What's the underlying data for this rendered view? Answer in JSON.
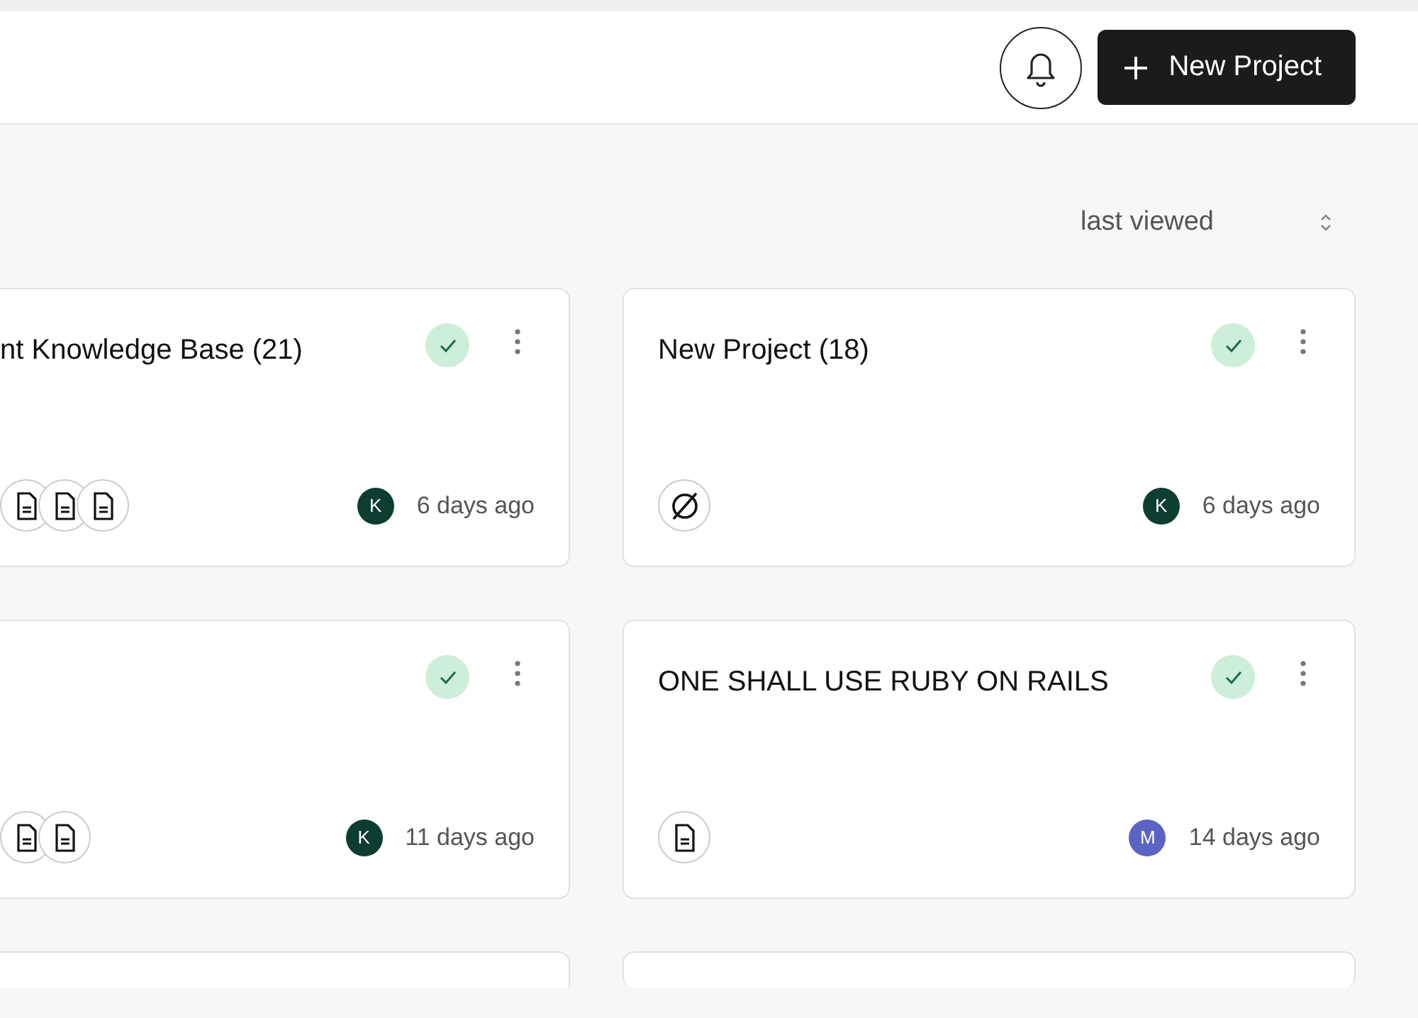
{
  "header": {
    "new_button": "New Project"
  },
  "sort": {
    "value": "last viewed"
  },
  "columns": [
    {
      "cards": [
        {
          "title": "nt Knowledge Base (21)",
          "synced": true,
          "attachments": [
            {
              "kind": "document"
            },
            {
              "kind": "document"
            },
            {
              "kind": "document"
            }
          ],
          "avatar": {
            "initial": "K",
            "color": "#0d3d30"
          },
          "time": "6 days ago"
        },
        {
          "synced": true,
          "attachments": [
            {
              "kind": "document"
            },
            {
              "kind": "document"
            }
          ],
          "avatar": {
            "initial": "K",
            "color": "#0d3d30"
          },
          "time": "11 days ago"
        }
      ]
    },
    {
      "cards": [
        {
          "title": "New Project (18)",
          "synced": true,
          "attachments": [
            {
              "kind": "none"
            }
          ],
          "avatar": {
            "initial": "K",
            "color": "#0d3d30"
          },
          "time": "6 days ago"
        },
        {
          "title": "ONE SHALL USE RUBY ON RAILS",
          "synced": true,
          "attachments": [
            {
              "kind": "document"
            }
          ],
          "avatar": {
            "initial": "M",
            "color": "#5b63c4"
          },
          "time": "14 days ago"
        }
      ]
    }
  ]
}
